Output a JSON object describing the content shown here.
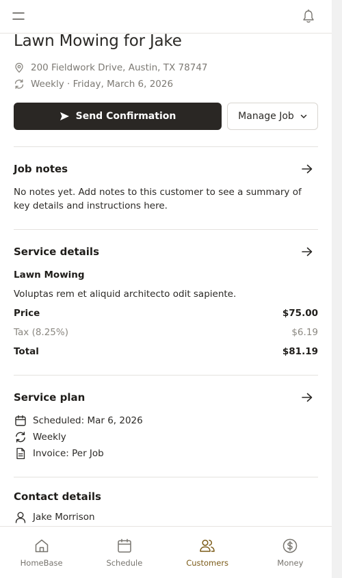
{
  "header": {
    "menu_icon": "hamburger-menu-icon",
    "notification_icon": "bell-icon"
  },
  "job": {
    "title": "Lawn Mowing for Jake",
    "address": "200 Fieldwork Drive, Austin, TX 78747",
    "schedule": "Weekly · Friday, March 6, 2026"
  },
  "actions": {
    "send_confirmation": "Send Confirmation",
    "manage_job": "Manage Job"
  },
  "job_notes": {
    "title": "Job notes",
    "body": "No notes yet. Add notes to this customer to see a summary of key details and instructions here."
  },
  "service_details": {
    "title": "Service details",
    "service_name": "Lawn Mowing",
    "description": "Voluptas rem et aliquid architecto odit sapiente.",
    "price_label": "Price",
    "price_value": "$75.00",
    "tax_label": "Tax (8.25%)",
    "tax_value": "$6.19",
    "total_label": "Total",
    "total_value": "$81.19"
  },
  "service_plan": {
    "title": "Service plan",
    "scheduled": "Scheduled: Mar 6, 2026",
    "frequency": "Weekly",
    "invoice": "Invoice: Per Job"
  },
  "contact_details": {
    "title": "Contact details",
    "name": "Jake Morrison"
  },
  "bottom_nav": {
    "items": [
      {
        "label": "HomeBase",
        "icon": "home-icon"
      },
      {
        "label": "Schedule",
        "icon": "calendar-icon"
      },
      {
        "label": "Customers",
        "icon": "users-icon",
        "active": true
      },
      {
        "label": "Money",
        "icon": "dollar-circle-icon"
      }
    ]
  },
  "colors": {
    "primary_button": "#2a2724",
    "active_nav": "#7a5a17",
    "muted_text": "#7c7973"
  }
}
